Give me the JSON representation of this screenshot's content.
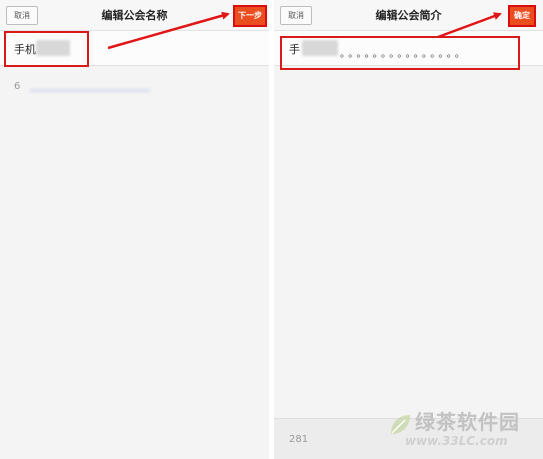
{
  "left": {
    "cancel_label": "取消",
    "title": "编辑公会名称",
    "next_label": "下一步",
    "name_value": "手机",
    "char_count": "6"
  },
  "right": {
    "cancel_label": "取消",
    "title": "编辑公会简介",
    "confirm_label": "确定",
    "intro_value": "手",
    "intro_dots": "。。。。。。。。。。。。。。。",
    "char_count": "281"
  },
  "watermark": {
    "name": "绿茶软件园",
    "url": "www.33LC.com"
  },
  "colors": {
    "accent": "#ea4d1e",
    "highlight": "#d81a1a"
  },
  "icons": [
    "leaf-logo-icon"
  ]
}
